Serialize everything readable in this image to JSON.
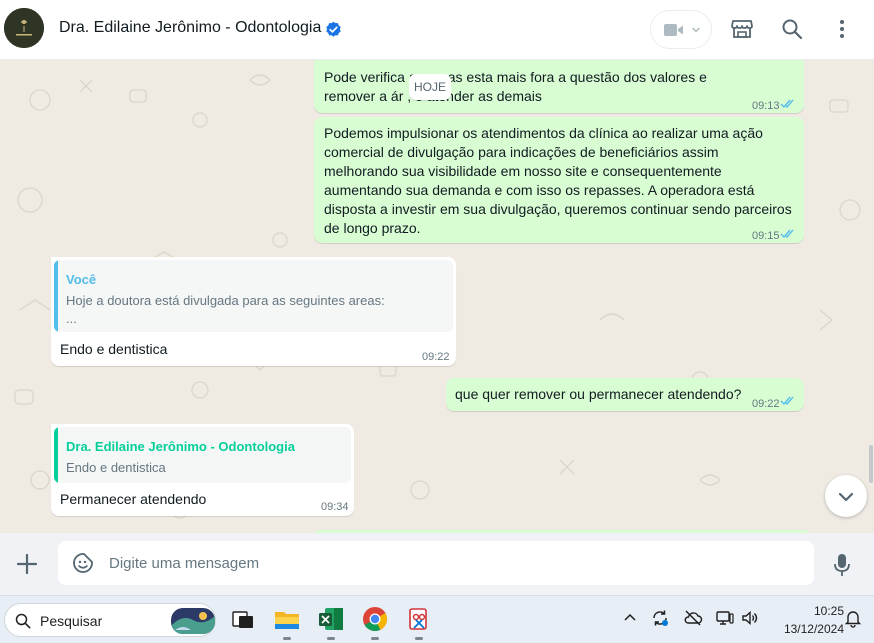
{
  "header": {
    "contact_name": "Dra. Edilaine Jerônimo - Odontologia",
    "verified_icon": "verified-badge-icon",
    "icons": [
      "video-call-icon",
      "chevron-down-icon",
      "business-store-icon",
      "search-icon",
      "menu-dots-icon"
    ]
  },
  "chat": {
    "date_divider": "HOJE",
    "messages": [
      {
        "direction": "out",
        "text": "Pode verifica        as areas esta mais fora a questão dos valores e\nremover a ár             , e atender as demais",
        "time": "09:13",
        "status": "read"
      },
      {
        "direction": "out",
        "text": "Podemos impulsionar os atendimentos da clínica ao realizar uma ação\ncomercial de divulgação para indicações de beneficiários assim\nmelhorando sua visibilidade em nosso site e consequentemente\naumentando sua demanda e com isso os repasses. A operadora está\ndisposta a investir em sua divulgação, queremos continuar sendo parceiros\nde longo prazo.",
        "time": "09:15",
        "status": "read"
      },
      {
        "direction": "in",
        "quote": {
          "author": "Você",
          "text": "Hoje a doutora está divulgada para as seguintes areas:",
          "text2": "..."
        },
        "text": "Endo e dentistica",
        "time": "09:22"
      },
      {
        "direction": "out",
        "text": "que quer remover ou permanecer atendendo?",
        "time": "09:22",
        "status": "read"
      },
      {
        "direction": "in",
        "quote": {
          "author": "Dra. Edilaine Jerônimo - Odontologia",
          "text": "Endo e dentistica"
        },
        "text": "Permanecer atendendo",
        "time": "09:34"
      }
    ]
  },
  "composer": {
    "placeholder": "Digite uma mensagem",
    "icons": [
      "plus-icon",
      "sticker-emoji-icon",
      "microphone-icon"
    ]
  },
  "taskbar": {
    "search_label": "Pesquisar",
    "apps": [
      "task-view-icon",
      "file-explorer-icon",
      "excel-icon",
      "chrome-icon",
      "snipping-tool-icon"
    ],
    "tray_icons": [
      "chevron-up-icon",
      "sync-icon",
      "cloud-offline-icon",
      "display-icon",
      "speaker-icon",
      "notification-bell-icon"
    ],
    "time": "10:25",
    "date": "13/12/2024"
  },
  "colors": {
    "outgoing_bubble": "#d9fdd3",
    "incoming_bubble": "#ffffff",
    "chat_background": "#efeae2",
    "read_ticks": "#53bdeb",
    "quote_self": "#53bdeb",
    "quote_contact": "#06cf9c",
    "verified": "#1b74e4"
  }
}
